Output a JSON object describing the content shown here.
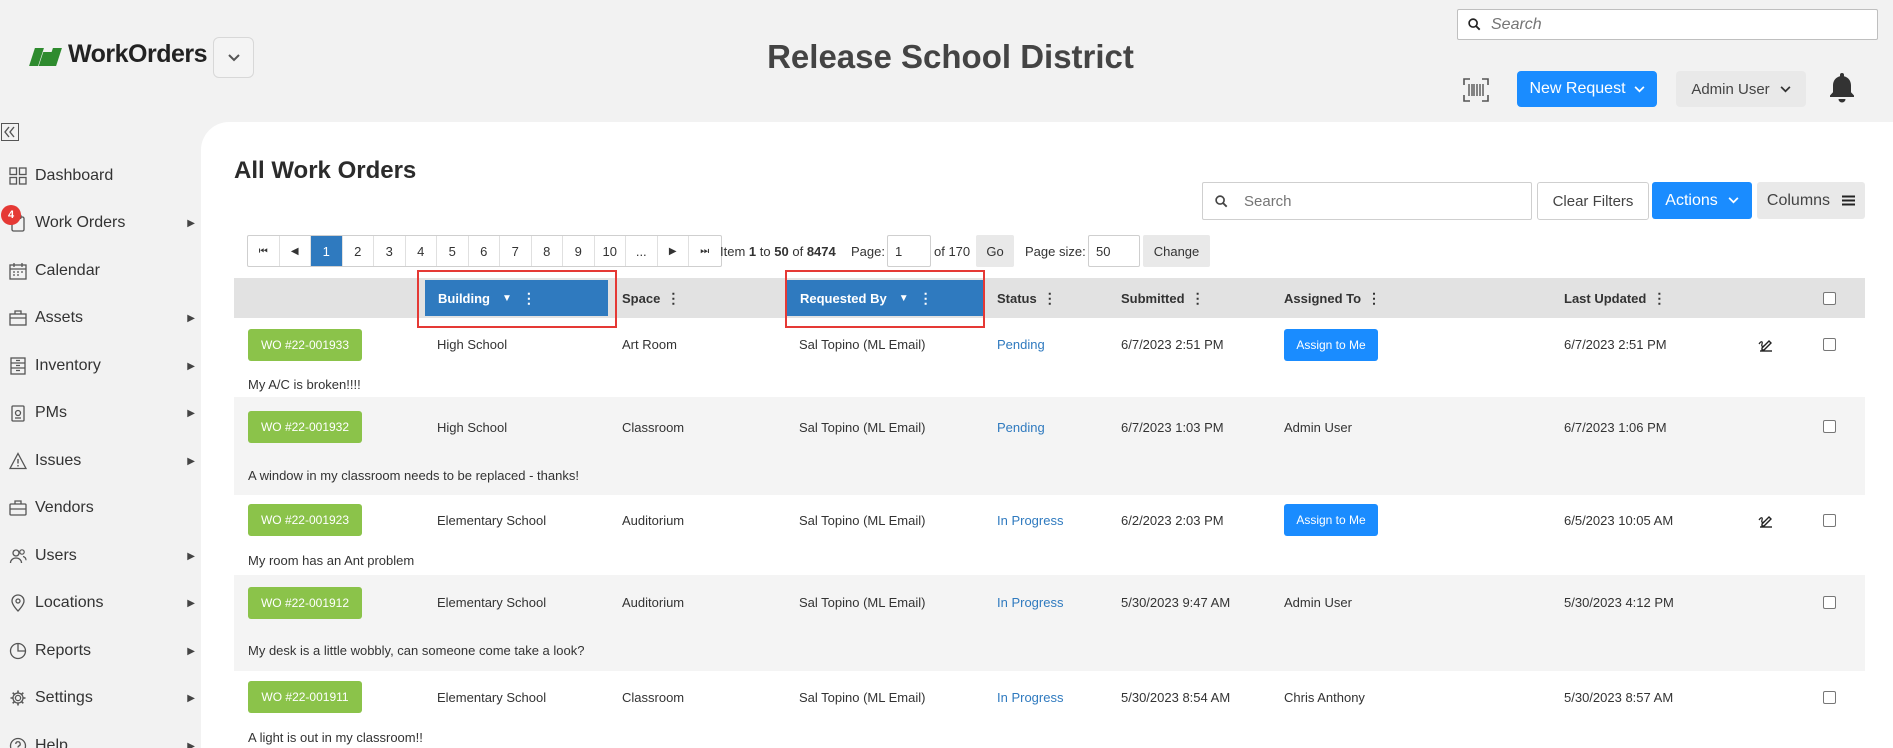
{
  "header": {
    "logo_text": "WorkOrders",
    "district": "Release School District",
    "search_placeholder": "Search",
    "new_request": "New Request",
    "user": "Admin User"
  },
  "sidebar": {
    "items": [
      {
        "label": "Dashboard",
        "icon": "grid-icon"
      },
      {
        "label": "Work Orders",
        "icon": "clipboard-icon",
        "badge": "4"
      },
      {
        "label": "Calendar",
        "icon": "calendar-icon"
      },
      {
        "label": "Assets",
        "icon": "briefcase-icon"
      },
      {
        "label": "Inventory",
        "icon": "inventory-icon"
      },
      {
        "label": "PMs",
        "icon": "pm-icon"
      },
      {
        "label": "Issues",
        "icon": "warning-icon"
      },
      {
        "label": "Vendors",
        "icon": "vendor-icon"
      },
      {
        "label": "Users",
        "icon": "users-icon"
      },
      {
        "label": "Locations",
        "icon": "pin-icon"
      },
      {
        "label": "Reports",
        "icon": "chart-icon"
      },
      {
        "label": "Settings",
        "icon": "gear-icon"
      },
      {
        "label": "Help",
        "icon": "help-icon"
      }
    ]
  },
  "main": {
    "title": "All Work Orders",
    "search_placeholder": "Search",
    "clear_filters": "Clear Filters",
    "actions": "Actions",
    "columns": "Columns"
  },
  "pager": {
    "pages": [
      "1",
      "2",
      "3",
      "4",
      "5",
      "6",
      "7",
      "8",
      "9",
      "10",
      "..."
    ],
    "item_label": "Item",
    "item_from": "1",
    "to_label": "to",
    "item_to": "50",
    "of_label": "of",
    "total_items": "8474",
    "page_label": "Page:",
    "page_value": "1",
    "of_pages": "of 170",
    "go": "Go",
    "size_label": "Page size:",
    "size_value": "50",
    "change": "Change"
  },
  "table": {
    "headers": {
      "building": "Building",
      "space": "Space",
      "requested_by": "Requested By",
      "status": "Status",
      "submitted": "Submitted",
      "assigned_to": "Assigned To",
      "last_updated": "Last Updated"
    },
    "rows": [
      {
        "wo": "WO #22-001933",
        "building": "High School",
        "space": "Art Room",
        "requested_by": "Sal Topino (ML Email)",
        "status": "Pending",
        "submitted": "6/7/2023 2:51 PM",
        "assigned": "Assign to Me",
        "assign_button": true,
        "updated": "6/7/2023 2:51 PM",
        "desc": "My A/C is broken!!!!"
      },
      {
        "wo": "WO #22-001932",
        "building": "High School",
        "space": "Classroom",
        "requested_by": "Sal Topino (ML Email)",
        "status": "Pending",
        "submitted": "6/7/2023 1:03 PM",
        "assigned": "Admin User",
        "assign_button": false,
        "updated": "6/7/2023 1:06 PM",
        "desc": "A window in my classroom needs to be replaced - thanks!"
      },
      {
        "wo": "WO #22-001923",
        "building": "Elementary School",
        "space": "Auditorium",
        "requested_by": "Sal Topino (ML Email)",
        "status": "In Progress",
        "submitted": "6/2/2023 2:03 PM",
        "assigned": "Assign to Me",
        "assign_button": true,
        "updated": "6/5/2023 10:05 AM",
        "desc": "My room has an Ant problem"
      },
      {
        "wo": "WO #22-001912",
        "building": "Elementary School",
        "space": "Auditorium",
        "requested_by": "Sal Topino (ML Email)",
        "status": "In Progress",
        "submitted": "5/30/2023 9:47 AM",
        "assigned": "Admin User",
        "assign_button": false,
        "updated": "5/30/2023 4:12 PM",
        "desc": "My desk is a little wobbly, can someone come take a look?"
      },
      {
        "wo": "WO #22-001911",
        "building": "Elementary School",
        "space": "Classroom",
        "requested_by": "Sal Topino (ML Email)",
        "status": "In Progress",
        "submitted": "5/30/2023 8:54 AM",
        "assigned": "Chris Anthony",
        "assign_button": false,
        "updated": "5/30/2023 8:57 AM",
        "desc": "A light is out in my classroom!!"
      }
    ]
  },
  "colors": {
    "primary": "#1a8cff",
    "header_selected": "#2f7abf",
    "wo_badge": "#8bc34a",
    "highlight": "#e53935"
  }
}
